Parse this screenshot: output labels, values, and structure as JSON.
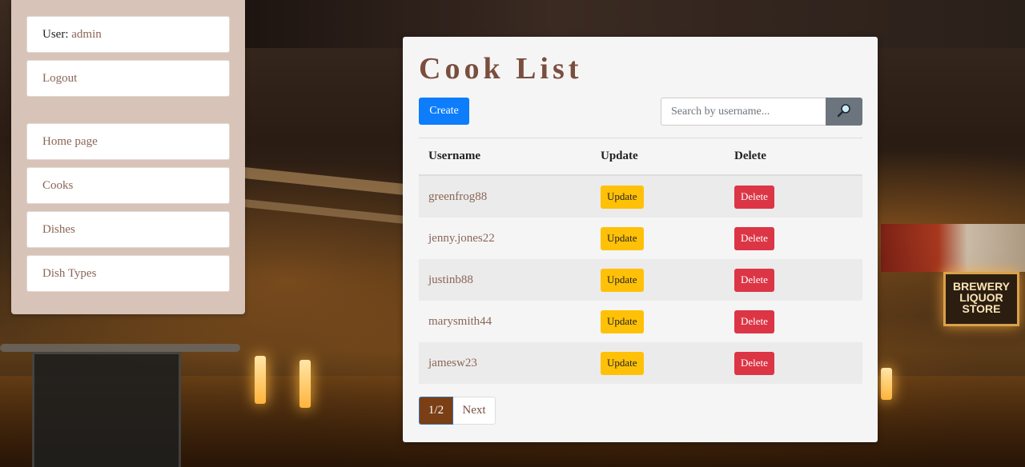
{
  "sidebar": {
    "user_label": "User:",
    "user_name": "admin",
    "logout": "Logout",
    "nav": [
      "Home page",
      "Cooks",
      "Dishes",
      "Dish Types"
    ]
  },
  "main": {
    "title": "Cook List",
    "create_label": "Create",
    "search": {
      "placeholder": "Search by username...",
      "icon": "search-icon"
    },
    "table": {
      "headers": [
        "Username",
        "Update",
        "Delete"
      ],
      "rows": [
        {
          "username": "greenfrog88",
          "update": "Update",
          "delete": "Delete"
        },
        {
          "username": "jenny.jones22",
          "update": "Update",
          "delete": "Delete"
        },
        {
          "username": "justinb88",
          "update": "Update",
          "delete": "Delete"
        },
        {
          "username": "marysmith44",
          "update": "Update",
          "delete": "Delete"
        },
        {
          "username": "jamesw23",
          "update": "Update",
          "delete": "Delete"
        }
      ]
    },
    "pagination": {
      "current": "1/2",
      "next": "Next"
    }
  },
  "background": {
    "sign_text": "BREWERY LIQUOR STORE"
  },
  "colors": {
    "title": "#7a4e3f",
    "create": "#0d7dfb",
    "update": "#ffc107",
    "delete": "#dc3545",
    "search_button": "#6c757d",
    "sidebar_bg": "#d8c3b8",
    "page_current": "#7a3f15"
  }
}
